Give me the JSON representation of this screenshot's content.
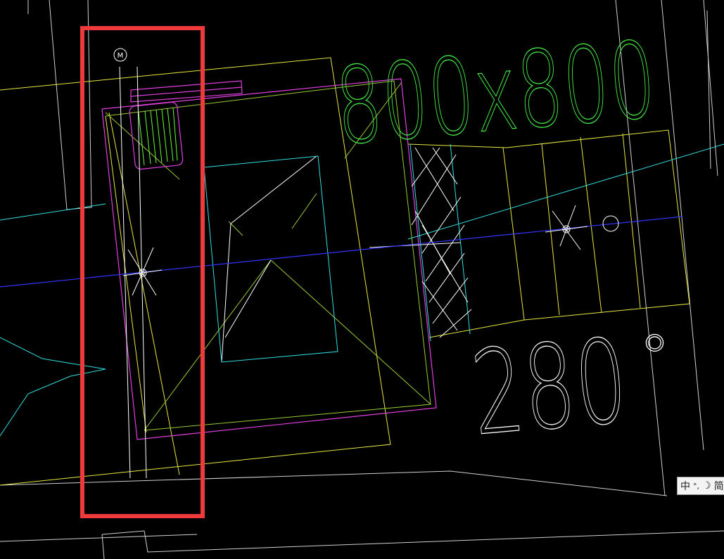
{
  "drawing": {
    "dimension_top": "800x800",
    "dimension_bottom": "280",
    "degree_mark": "°",
    "north_marker": "M"
  },
  "ime_toolbar": {
    "mode": "中",
    "punct": "°,",
    "moon": "☽",
    "extra": "简"
  },
  "colors": {
    "background": "#000000",
    "yellow": "#ffff33",
    "cyan": "#33ffff",
    "magenta": "#ff33ff",
    "green": "#33ff33",
    "white": "#ffffff",
    "blue": "#3333ff",
    "olive": "#99cc33",
    "highlight": "#ee3a3a"
  }
}
